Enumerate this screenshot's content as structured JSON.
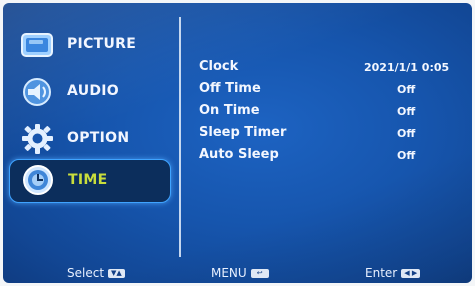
{
  "menu": {
    "items": [
      {
        "label": "PICTURE",
        "icon": "picture-icon",
        "selected": false
      },
      {
        "label": "AUDIO",
        "icon": "audio-icon",
        "selected": false
      },
      {
        "label": "OPTION",
        "icon": "option-gear-icon",
        "selected": false
      },
      {
        "label": "TIME",
        "icon": "time-clock-icon",
        "selected": true
      }
    ]
  },
  "settings": {
    "rows": [
      {
        "name": "Clock",
        "value": "2021/1/1 0:05"
      },
      {
        "name": "Off Time",
        "value": "Off"
      },
      {
        "name": "On Time",
        "value": "Off"
      },
      {
        "name": "Sleep Timer",
        "value": "Off"
      },
      {
        "name": "Auto Sleep",
        "value": "Off"
      }
    ]
  },
  "footer": {
    "select_label": "Select",
    "select_key": "▼▲",
    "menu_label": "MENU",
    "menu_key": "↩",
    "enter_label": "Enter",
    "enter_key": "◀ ▶"
  },
  "colors": {
    "background": "#1655ad",
    "selected_label": "#c9dd3c",
    "selected_border": "#3fa3ff"
  }
}
